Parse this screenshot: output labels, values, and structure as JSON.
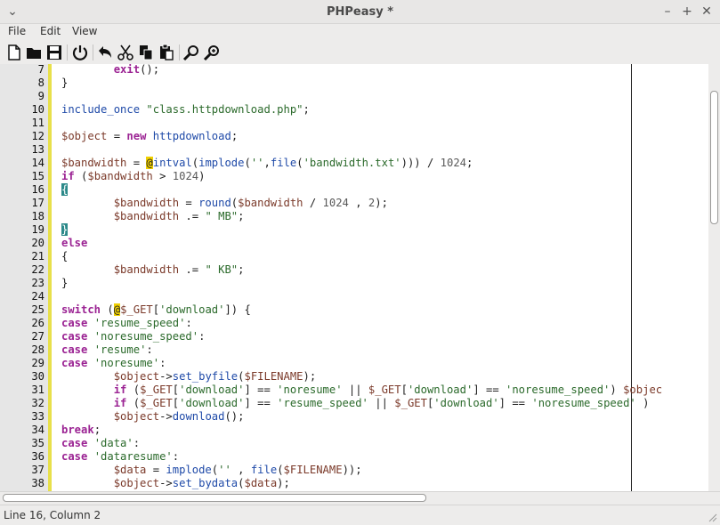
{
  "window": {
    "title": "PHPeasy *"
  },
  "menu": {
    "file": "File",
    "edit": "Edit",
    "view": "View"
  },
  "toolbar": [
    "new-file",
    "open-folder",
    "save",
    "power",
    "undo",
    "cut",
    "copy",
    "paste",
    "find",
    "find-replace"
  ],
  "status": {
    "text": "Line 16, Column 2"
  },
  "editor": {
    "lines": [
      {
        "n": "7",
        "tokens": [
          [
            "o",
            "        "
          ],
          [
            "kw",
            "exit"
          ],
          [
            "o",
            "();"
          ]
        ]
      },
      {
        "n": "8",
        "tokens": [
          [
            "o",
            "}"
          ]
        ]
      },
      {
        "n": "9",
        "tokens": []
      },
      {
        "n": "10",
        "tokens": [
          [
            "fn",
            "include_once"
          ],
          [
            "o",
            " "
          ],
          [
            "str",
            "\"class.httpdownload.php\""
          ],
          [
            "o",
            ";"
          ]
        ]
      },
      {
        "n": "11",
        "tokens": []
      },
      {
        "n": "12",
        "tokens": [
          [
            "var",
            "$object"
          ],
          [
            "o",
            " = "
          ],
          [
            "kw",
            "new"
          ],
          [
            "o",
            " "
          ],
          [
            "fn",
            "httpdownload"
          ],
          [
            "o",
            ";"
          ]
        ]
      },
      {
        "n": "13",
        "tokens": []
      },
      {
        "n": "14",
        "tokens": [
          [
            "var",
            "$bandwidth"
          ],
          [
            "o",
            " = "
          ],
          [
            "at",
            "@"
          ],
          [
            "fn",
            "intval"
          ],
          [
            "o",
            "("
          ],
          [
            "fn",
            "implode"
          ],
          [
            "o",
            "("
          ],
          [
            "str",
            "''"
          ],
          [
            "o",
            ","
          ],
          [
            "fn",
            "file"
          ],
          [
            "o",
            "("
          ],
          [
            "str",
            "'bandwidth.txt'"
          ],
          [
            "o",
            ")))"
          ],
          [
            "o",
            " / "
          ],
          [
            "num",
            "1024"
          ],
          [
            "o",
            ";"
          ]
        ]
      },
      {
        "n": "15",
        "tokens": [
          [
            "kw",
            "if"
          ],
          [
            "o",
            " ("
          ],
          [
            "var",
            "$bandwidth"
          ],
          [
            "o",
            " > "
          ],
          [
            "num",
            "1024"
          ],
          [
            "o",
            ")"
          ]
        ]
      },
      {
        "n": "16",
        "tokens": [
          [
            "brm",
            "{"
          ]
        ]
      },
      {
        "n": "17",
        "tokens": [
          [
            "o",
            "        "
          ],
          [
            "var",
            "$bandwidth"
          ],
          [
            "o",
            " = "
          ],
          [
            "fn",
            "round"
          ],
          [
            "o",
            "("
          ],
          [
            "var",
            "$bandwidth"
          ],
          [
            "o",
            " / "
          ],
          [
            "num",
            "1024"
          ],
          [
            "o",
            " , "
          ],
          [
            "num",
            "2"
          ],
          [
            "o",
            ");"
          ]
        ]
      },
      {
        "n": "18",
        "tokens": [
          [
            "o",
            "        "
          ],
          [
            "var",
            "$bandwidth"
          ],
          [
            "o",
            " .= "
          ],
          [
            "str",
            "\" MB\""
          ],
          [
            "o",
            ";"
          ]
        ]
      },
      {
        "n": "19",
        "tokens": [
          [
            "brm",
            "}"
          ]
        ]
      },
      {
        "n": "20",
        "tokens": [
          [
            "kw",
            "else"
          ]
        ]
      },
      {
        "n": "21",
        "tokens": [
          [
            "o",
            "{"
          ]
        ]
      },
      {
        "n": "22",
        "tokens": [
          [
            "o",
            "        "
          ],
          [
            "var",
            "$bandwidth"
          ],
          [
            "o",
            " .= "
          ],
          [
            "str",
            "\" KB\""
          ],
          [
            "o",
            ";"
          ]
        ]
      },
      {
        "n": "23",
        "tokens": [
          [
            "o",
            "}"
          ]
        ]
      },
      {
        "n": "24",
        "tokens": []
      },
      {
        "n": "25",
        "tokens": [
          [
            "kw",
            "switch"
          ],
          [
            "o",
            " ("
          ],
          [
            "at",
            "@"
          ],
          [
            "var",
            "$_GET"
          ],
          [
            "o",
            "["
          ],
          [
            "str",
            "'download'"
          ],
          [
            "o",
            "]) {"
          ]
        ]
      },
      {
        "n": "26",
        "tokens": [
          [
            "kw",
            "case"
          ],
          [
            "o",
            " "
          ],
          [
            "str",
            "'resume_speed'"
          ],
          [
            "o",
            ":"
          ]
        ]
      },
      {
        "n": "27",
        "tokens": [
          [
            "kw",
            "case"
          ],
          [
            "o",
            " "
          ],
          [
            "str",
            "'noresume_speed'"
          ],
          [
            "o",
            ":"
          ]
        ]
      },
      {
        "n": "28",
        "tokens": [
          [
            "kw",
            "case"
          ],
          [
            "o",
            " "
          ],
          [
            "str",
            "'resume'"
          ],
          [
            "o",
            ":"
          ]
        ]
      },
      {
        "n": "29",
        "tokens": [
          [
            "kw",
            "case"
          ],
          [
            "o",
            " "
          ],
          [
            "str",
            "'noresume'"
          ],
          [
            "o",
            ":"
          ]
        ]
      },
      {
        "n": "30",
        "tokens": [
          [
            "o",
            "        "
          ],
          [
            "var",
            "$object"
          ],
          [
            "o",
            "->"
          ],
          [
            "fn",
            "set_byfile"
          ],
          [
            "o",
            "("
          ],
          [
            "var",
            "$FILENAME"
          ],
          [
            "o",
            ");"
          ]
        ]
      },
      {
        "n": "31",
        "tokens": [
          [
            "o",
            "        "
          ],
          [
            "kw",
            "if"
          ],
          [
            "o",
            " ("
          ],
          [
            "var",
            "$_GET"
          ],
          [
            "o",
            "["
          ],
          [
            "str",
            "'download'"
          ],
          [
            "o",
            "] == "
          ],
          [
            "str",
            "'noresume'"
          ],
          [
            "o",
            " || "
          ],
          [
            "var",
            "$_GET"
          ],
          [
            "o",
            "["
          ],
          [
            "str",
            "'download'"
          ],
          [
            "o",
            "] == "
          ],
          [
            "str",
            "'noresume_speed'"
          ],
          [
            "o",
            ") "
          ],
          [
            "var",
            "$objec"
          ]
        ]
      },
      {
        "n": "32",
        "tokens": [
          [
            "o",
            "        "
          ],
          [
            "kw",
            "if"
          ],
          [
            "o",
            " ("
          ],
          [
            "var",
            "$_GET"
          ],
          [
            "o",
            "["
          ],
          [
            "str",
            "'download'"
          ],
          [
            "o",
            "] == "
          ],
          [
            "str",
            "'resume_speed'"
          ],
          [
            "o",
            " || "
          ],
          [
            "var",
            "$_GET"
          ],
          [
            "o",
            "["
          ],
          [
            "str",
            "'download'"
          ],
          [
            "o",
            "] == "
          ],
          [
            "str",
            "'noresume_speed'"
          ],
          [
            "o",
            " )"
          ]
        ]
      },
      {
        "n": "33",
        "tokens": [
          [
            "o",
            "        "
          ],
          [
            "var",
            "$object"
          ],
          [
            "o",
            "->"
          ],
          [
            "fn",
            "download"
          ],
          [
            "o",
            "();"
          ]
        ]
      },
      {
        "n": "34",
        "tokens": [
          [
            "kw",
            "break"
          ],
          [
            "o",
            ";"
          ]
        ]
      },
      {
        "n": "35",
        "tokens": [
          [
            "kw",
            "case"
          ],
          [
            "o",
            " "
          ],
          [
            "str",
            "'data'"
          ],
          [
            "o",
            ":"
          ]
        ]
      },
      {
        "n": "36",
        "tokens": [
          [
            "kw",
            "case"
          ],
          [
            "o",
            " "
          ],
          [
            "str",
            "'dataresume'"
          ],
          [
            "o",
            ":"
          ]
        ]
      },
      {
        "n": "37",
        "tokens": [
          [
            "o",
            "        "
          ],
          [
            "var",
            "$data"
          ],
          [
            "o",
            " = "
          ],
          [
            "fn",
            "implode"
          ],
          [
            "o",
            "("
          ],
          [
            "str",
            "''"
          ],
          [
            "o",
            " , "
          ],
          [
            "fn",
            "file"
          ],
          [
            "o",
            "("
          ],
          [
            "var",
            "$FILENAME"
          ],
          [
            "o",
            "));"
          ]
        ]
      },
      {
        "n": "38",
        "tokens": [
          [
            "o",
            "        "
          ],
          [
            "var",
            "$object"
          ],
          [
            "o",
            "->"
          ],
          [
            "fn",
            "set_bydata"
          ],
          [
            "o",
            "("
          ],
          [
            "var",
            "$data"
          ],
          [
            "o",
            ");"
          ]
        ]
      }
    ]
  }
}
